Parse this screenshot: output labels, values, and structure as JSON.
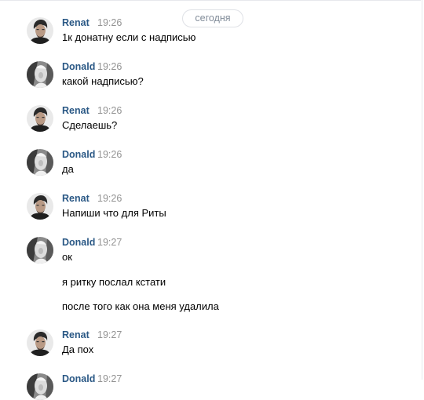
{
  "date_divider": "сегодня",
  "messages": [
    {
      "author": "Renat",
      "time": "19:26",
      "avatar": "renat-avatar",
      "lines": [
        "1к донатну если с надписью"
      ]
    },
    {
      "author": "Donald",
      "time": "19:26",
      "avatar": "donald-avatar",
      "lines": [
        "какой надписью?"
      ]
    },
    {
      "author": "Renat",
      "time": "19:26",
      "avatar": "renat-avatar",
      "lines": [
        "Сделаешь?"
      ]
    },
    {
      "author": "Donald",
      "time": "19:26",
      "avatar": "donald-avatar",
      "lines": [
        "да"
      ]
    },
    {
      "author": "Renat",
      "time": "19:26",
      "avatar": "renat-avatar",
      "lines": [
        "Напиши что для Риты"
      ]
    },
    {
      "author": "Donald",
      "time": "19:27",
      "avatar": "donald-avatar",
      "lines": [
        "ок",
        "я ритку послал кстати",
        "после того как она меня удалила"
      ]
    },
    {
      "author": "Renat",
      "time": "19:27",
      "avatar": "renat-avatar",
      "lines": [
        "Да пох"
      ]
    },
    {
      "author": "Donald",
      "time": "19:27",
      "avatar": "donald-avatar",
      "lines": []
    }
  ]
}
